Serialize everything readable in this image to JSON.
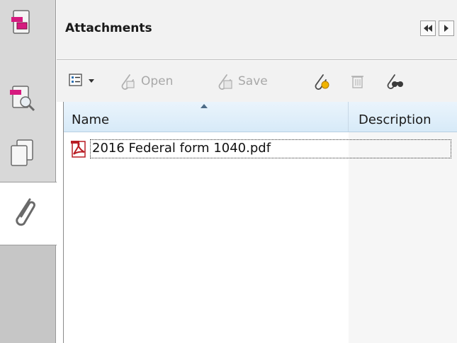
{
  "rail": {
    "items": [
      {
        "name": "pages-icon"
      },
      {
        "name": "signatures-icon"
      },
      {
        "name": "layers-icon"
      },
      {
        "name": "attachments-icon",
        "active": true
      }
    ]
  },
  "panel": {
    "title": "Attachments"
  },
  "toolbar": {
    "open_label": "Open",
    "save_label": "Save"
  },
  "list": {
    "columns": [
      "Name",
      "Description"
    ],
    "rows": [
      {
        "name": "2016 Federal form 1040.pdf",
        "description": ""
      }
    ]
  },
  "colors": {
    "pdf_red": "#b81c23",
    "header_blue": "#d7eaf8",
    "disabled_text": "#a8a8a8"
  }
}
